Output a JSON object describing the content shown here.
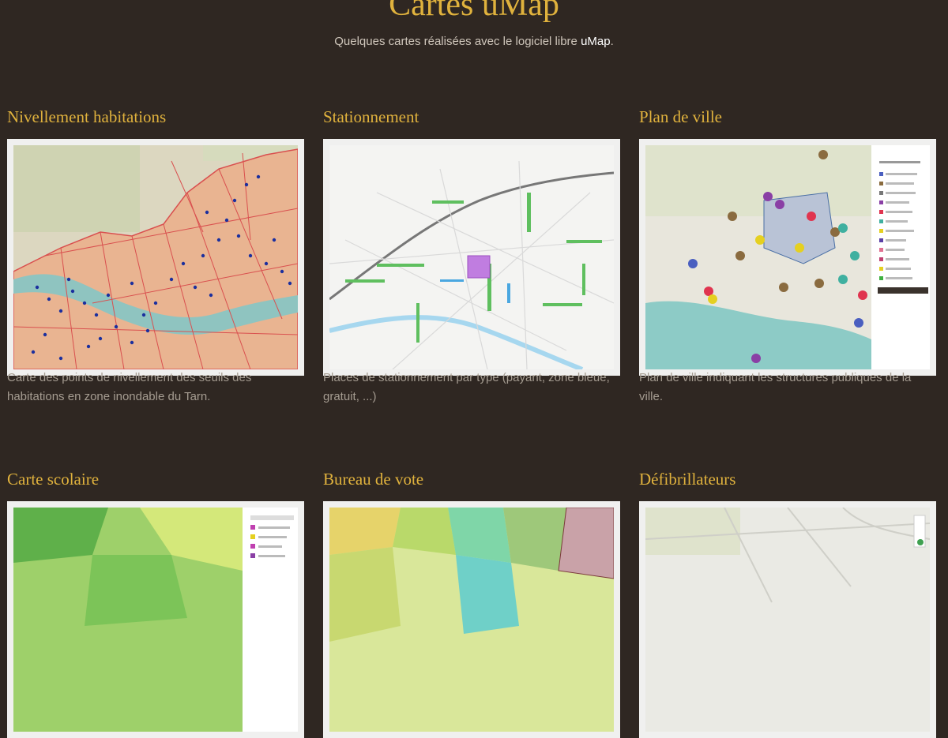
{
  "header": {
    "title": "Cartes uMap",
    "subtitle_prefix": "Quelques cartes réalisées avec le logiciel libre ",
    "subtitle_link": "uMap",
    "subtitle_suffix": "."
  },
  "cards": [
    {
      "title": "Nivellement habitations",
      "description": "Carte des points de nivellement des seuils des habitations en zone inondable du Tarn."
    },
    {
      "title": "Stationnement",
      "description": "Places de stationnement par type (payant, zone bleue, gratuit, ...)"
    },
    {
      "title": "Plan de ville",
      "description": "Plan de ville indiquant les structures publiques de la ville."
    },
    {
      "title": "Carte scolaire",
      "description": ""
    },
    {
      "title": "Bureau de vote",
      "description": ""
    },
    {
      "title": "Défibrillateurs",
      "description": ""
    }
  ],
  "colors": {
    "background": "#2f2722",
    "accent": "#e0b23d",
    "text": "#a59c91"
  }
}
